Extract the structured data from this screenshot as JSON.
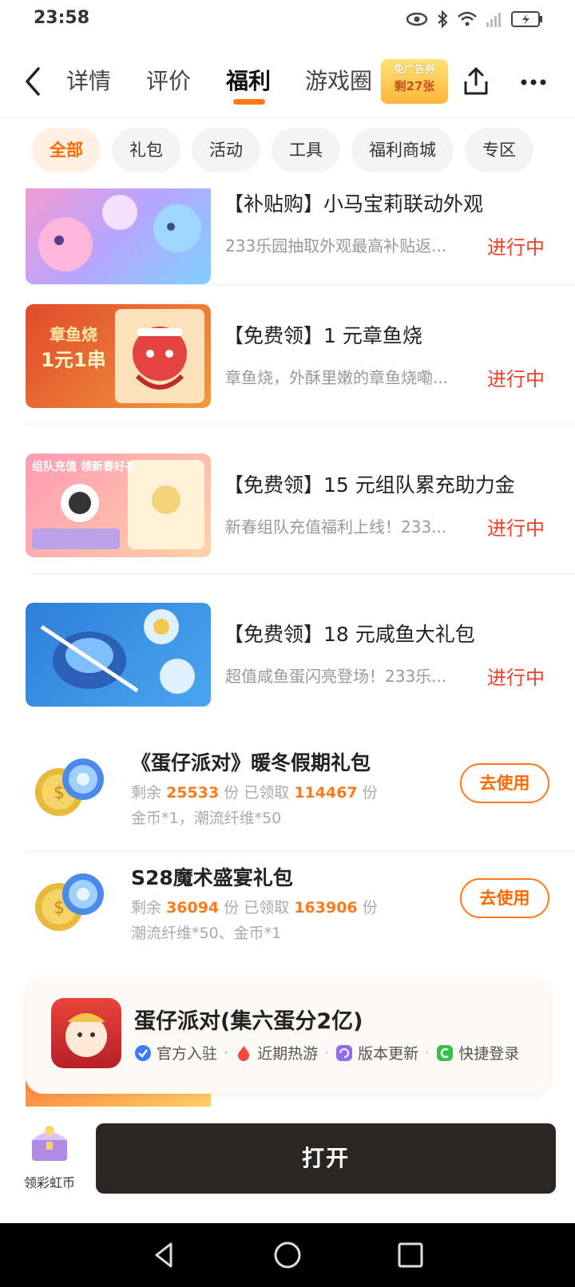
{
  "status_bar": {
    "time": "23:58"
  },
  "nav": {
    "tabs": [
      {
        "label": "详情"
      },
      {
        "label": "评价"
      },
      {
        "label": "福利"
      },
      {
        "label": "游戏圈"
      }
    ],
    "active_tab": "福利",
    "ad_badge": {
      "line1": "免广告券",
      "line2": "剩27张"
    }
  },
  "chips": [
    {
      "label": "全部",
      "active": true
    },
    {
      "label": "礼包"
    },
    {
      "label": "活动"
    },
    {
      "label": "工具"
    },
    {
      "label": "福利商城"
    },
    {
      "label": "专区"
    }
  ],
  "events": [
    {
      "title": "【补贴购】小马宝莉联动外观",
      "subtitle": "233乐园抽取外观最高补贴返...",
      "status": "进行中"
    },
    {
      "title": "【免费领】1 元章鱼烧",
      "subtitle": "章鱼烧，外酥里嫩的章鱼烧嘞...",
      "status": "进行中",
      "thumb_text1": "章鱼烧",
      "thumb_text2": "1元1串"
    },
    {
      "title": "【免费领】15 元组队累充助力金",
      "subtitle": "新春组队充值福利上线！233...",
      "status": "进行中",
      "thumb_text1": "组队充值 领新春好礼"
    },
    {
      "title": "【免费领】18 元咸鱼大礼包",
      "subtitle": "超值咸鱼蛋闪亮登场！233乐...",
      "status": "进行中"
    }
  ],
  "gifts": [
    {
      "title": "《蛋仔派对》暖冬假期礼包",
      "remain_label": "剩余",
      "remain": "25533",
      "unit1": "份 已领取",
      "taken": "114467",
      "unit2": "份",
      "items": "金币*1，潮流纤维*50",
      "button": "去使用"
    },
    {
      "title": "S28魔术盛宴礼包",
      "remain_label": "剩余",
      "remain": "36094",
      "unit1": "份 已领取",
      "taken": "163906",
      "unit2": "份",
      "items": "潮流纤维*50、金币*1",
      "button": "去使用"
    }
  ],
  "game_card": {
    "name": "蛋仔派对(集六蛋分2亿)",
    "tags": [
      "官方入驻",
      "近期热游",
      "版本更新",
      "快捷登录"
    ]
  },
  "bottom": {
    "bonus_label": "领彩虹币",
    "open_button": "打开"
  },
  "colors": {
    "accent": "#ff6a00",
    "status_red": "#f0402a",
    "open_button_bg": "#2b2523"
  }
}
